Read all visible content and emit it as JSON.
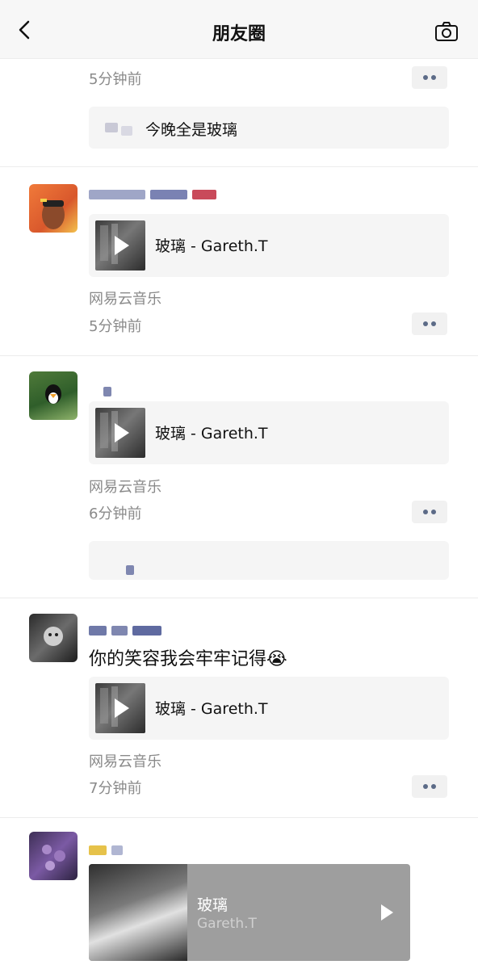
{
  "header": {
    "title": "朋友圈"
  },
  "posts": [
    {
      "time": "5分钟前",
      "comment": "今晚全是玻璃"
    },
    {
      "music_title": "玻璃 - Gareth.T",
      "source": "网易云音乐",
      "time": "5分钟前"
    },
    {
      "music_title": "玻璃 - Gareth.T",
      "source": "网易云音乐",
      "time": "6分钟前"
    },
    {
      "text": "你的笑容我会牢牢记得😭",
      "music_title": "玻璃 - Gareth.T",
      "source": "网易云音乐",
      "time": "7分钟前"
    },
    {
      "song": "玻璃",
      "artist": "Gareth.T"
    }
  ],
  "icons": {
    "back": "chevron-left-icon",
    "camera": "camera-icon",
    "more": "more-dots-icon",
    "play": "play-icon"
  },
  "colors": {
    "accent": "#5c6b87",
    "gray_text": "#8a8a8a",
    "card_bg": "#f5f5f5"
  }
}
